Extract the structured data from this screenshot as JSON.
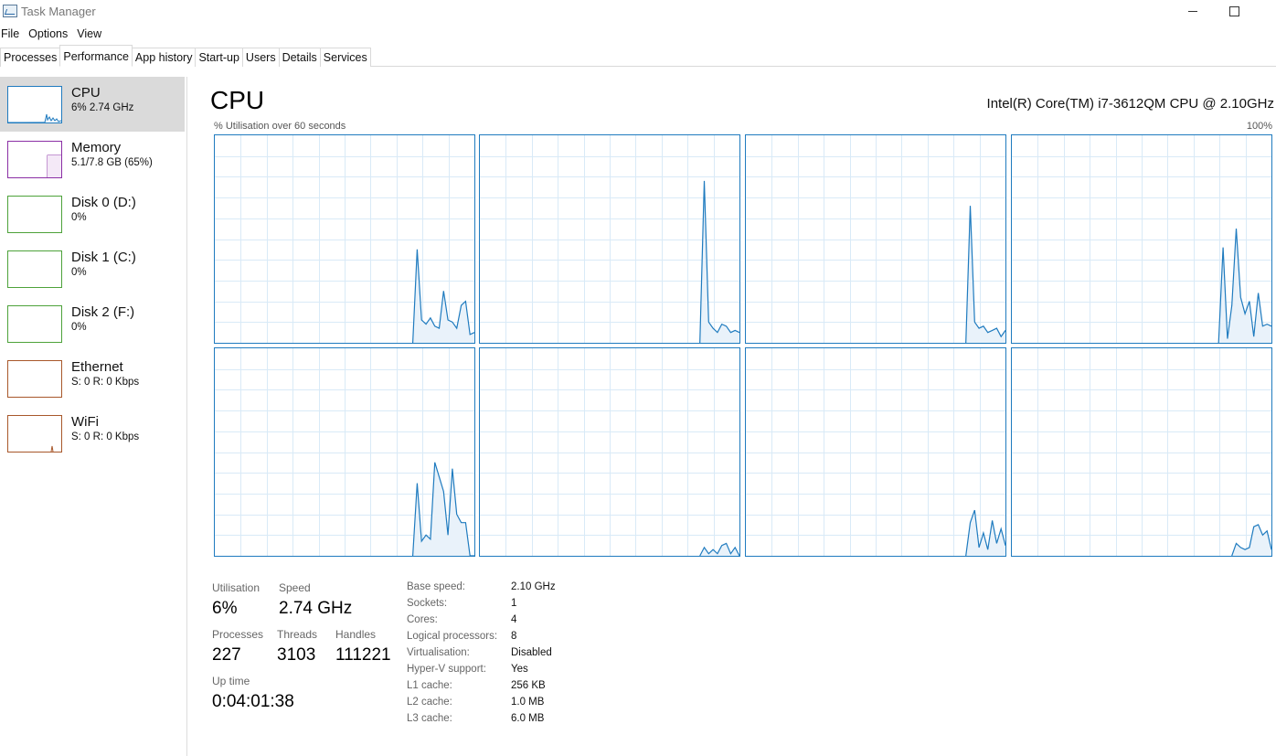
{
  "window": {
    "title": "Task Manager"
  },
  "menu": [
    "File",
    "Options",
    "View"
  ],
  "tabs": [
    "Processes",
    "Performance",
    "App history",
    "Start-up",
    "Users",
    "Details",
    "Services"
  ],
  "active_tab": "Performance",
  "sidebar": [
    {
      "title": "CPU",
      "sub": "6% 2.74 GHz",
      "color": "#1f7bbf"
    },
    {
      "title": "Memory",
      "sub": "5.1/7.8 GB (65%)",
      "color": "#8b2fa5"
    },
    {
      "title": "Disk 0 (D:)",
      "sub": "0%",
      "color": "#4da23a"
    },
    {
      "title": "Disk 1 (C:)",
      "sub": "0%",
      "color": "#4da23a"
    },
    {
      "title": "Disk 2 (F:)",
      "sub": "0%",
      "color": "#4da23a"
    },
    {
      "title": "Ethernet",
      "sub": "S: 0 R: 0 Kbps",
      "color": "#a8572a"
    },
    {
      "title": "WiFi",
      "sub": "S: 0 R: 0 Kbps",
      "color": "#a8572a"
    }
  ],
  "main": {
    "title": "CPU",
    "model": "Intel(R) Core(TM) i7-3612QM CPU @ 2.10GHz",
    "graph_caption": "% Utilisation over 60 seconds",
    "graph_max": "100%"
  },
  "cpu_graphs": [
    [
      0,
      0,
      0,
      0,
      0,
      0,
      0,
      0,
      0,
      0,
      0,
      0,
      0,
      0,
      0,
      0,
      0,
      0,
      0,
      0,
      0,
      0,
      0,
      0,
      0,
      0,
      0,
      0,
      0,
      0,
      0,
      0,
      0,
      0,
      0,
      0,
      0,
      0,
      0,
      0,
      0,
      0,
      0,
      0,
      0,
      0,
      45,
      11,
      9,
      12,
      8,
      7,
      25,
      11,
      10,
      7,
      18,
      20,
      4,
      5
    ],
    [
      0,
      0,
      0,
      0,
      0,
      0,
      0,
      0,
      0,
      0,
      0,
      0,
      0,
      0,
      0,
      0,
      0,
      0,
      0,
      0,
      0,
      0,
      0,
      0,
      0,
      0,
      0,
      0,
      0,
      0,
      0,
      0,
      0,
      0,
      0,
      0,
      0,
      0,
      0,
      0,
      0,
      0,
      0,
      0,
      0,
      0,
      0,
      0,
      0,
      0,
      0,
      78,
      10,
      7,
      5,
      9,
      8,
      5,
      6,
      5
    ],
    [
      0,
      0,
      0,
      0,
      0,
      0,
      0,
      0,
      0,
      0,
      0,
      0,
      0,
      0,
      0,
      0,
      0,
      0,
      0,
      0,
      0,
      0,
      0,
      0,
      0,
      0,
      0,
      0,
      0,
      0,
      0,
      0,
      0,
      0,
      0,
      0,
      0,
      0,
      0,
      0,
      0,
      0,
      0,
      0,
      0,
      0,
      0,
      0,
      0,
      0,
      0,
      66,
      10,
      7,
      8,
      5,
      6,
      7,
      3,
      6
    ],
    [
      0,
      0,
      0,
      0,
      0,
      0,
      0,
      0,
      0,
      0,
      0,
      0,
      0,
      0,
      0,
      0,
      0,
      0,
      0,
      0,
      0,
      0,
      0,
      0,
      0,
      0,
      0,
      0,
      0,
      0,
      0,
      0,
      0,
      0,
      0,
      0,
      0,
      0,
      0,
      0,
      0,
      0,
      0,
      0,
      0,
      0,
      0,
      0,
      46,
      2,
      18,
      55,
      22,
      14,
      20,
      3,
      24,
      8,
      9,
      8
    ],
    [
      0,
      0,
      0,
      0,
      0,
      0,
      0,
      0,
      0,
      0,
      0,
      0,
      0,
      0,
      0,
      0,
      0,
      0,
      0,
      0,
      0,
      0,
      0,
      0,
      0,
      0,
      0,
      0,
      0,
      0,
      0,
      0,
      0,
      0,
      0,
      0,
      0,
      0,
      0,
      0,
      0,
      0,
      0,
      0,
      0,
      0,
      35,
      7,
      10,
      8,
      45,
      38,
      31,
      10,
      42,
      20,
      16,
      16,
      0,
      0
    ],
    [
      0,
      0,
      0,
      0,
      0,
      0,
      0,
      0,
      0,
      0,
      0,
      0,
      0,
      0,
      0,
      0,
      0,
      0,
      0,
      0,
      0,
      0,
      0,
      0,
      0,
      0,
      0,
      0,
      0,
      0,
      0,
      0,
      0,
      0,
      0,
      0,
      0,
      0,
      0,
      0,
      0,
      0,
      0,
      0,
      0,
      0,
      0,
      0,
      0,
      0,
      0,
      4,
      1,
      3,
      1,
      5,
      6,
      1,
      4,
      0
    ],
    [
      0,
      0,
      0,
      0,
      0,
      0,
      0,
      0,
      0,
      0,
      0,
      0,
      0,
      0,
      0,
      0,
      0,
      0,
      0,
      0,
      0,
      0,
      0,
      0,
      0,
      0,
      0,
      0,
      0,
      0,
      0,
      0,
      0,
      0,
      0,
      0,
      0,
      0,
      0,
      0,
      0,
      0,
      0,
      0,
      0,
      0,
      0,
      0,
      0,
      0,
      0,
      16,
      22,
      4,
      11,
      3,
      17,
      6,
      13,
      5
    ],
    [
      0,
      0,
      0,
      0,
      0,
      0,
      0,
      0,
      0,
      0,
      0,
      0,
      0,
      0,
      0,
      0,
      0,
      0,
      0,
      0,
      0,
      0,
      0,
      0,
      0,
      0,
      0,
      0,
      0,
      0,
      0,
      0,
      0,
      0,
      0,
      0,
      0,
      0,
      0,
      0,
      0,
      0,
      0,
      0,
      0,
      0,
      0,
      0,
      0,
      0,
      0,
      6,
      4,
      3,
      4,
      14,
      15,
      10,
      12,
      3
    ]
  ],
  "stats": {
    "utilisation_label": "Utilisation",
    "utilisation": "6%",
    "speed_label": "Speed",
    "speed": "2.74 GHz",
    "processes_label": "Processes",
    "processes": "227",
    "threads_label": "Threads",
    "threads": "3103",
    "handles_label": "Handles",
    "handles": "111221",
    "uptime_label": "Up time",
    "uptime": "0:04:01:38"
  },
  "info": [
    {
      "label": "Base speed:",
      "value": "2.10 GHz"
    },
    {
      "label": "Sockets:",
      "value": "1"
    },
    {
      "label": "Cores:",
      "value": "4"
    },
    {
      "label": "Logical processors:",
      "value": "8"
    },
    {
      "label": "Virtualisation:",
      "value": "Disabled"
    },
    {
      "label": "Hyper-V support:",
      "value": "Yes"
    },
    {
      "label": "L1 cache:",
      "value": "256 KB"
    },
    {
      "label": "L2 cache:",
      "value": "1.0 MB"
    },
    {
      "label": "L3 cache:",
      "value": "6.0 MB"
    }
  ]
}
